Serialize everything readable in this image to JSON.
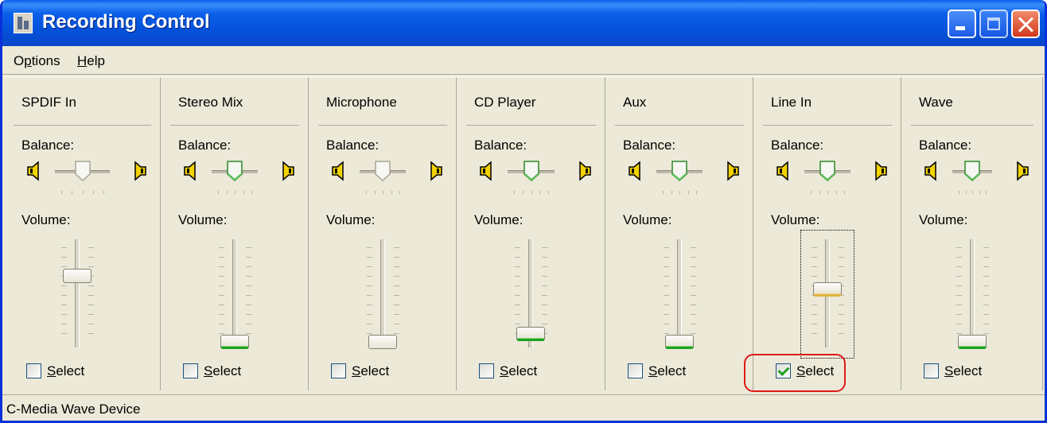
{
  "window": {
    "title": "Recording Control"
  },
  "menu": {
    "options": [
      "O",
      "p",
      "tions"
    ],
    "help": [
      "H",
      "elp"
    ]
  },
  "labels": {
    "balance": "Balance:",
    "volume": "Volume:",
    "select_first": "S",
    "select_rest": "elect"
  },
  "channels": [
    {
      "name": "SPDIF In",
      "balance": 0.5,
      "volume": 0.7,
      "selected": false,
      "active": false
    },
    {
      "name": "Stereo Mix",
      "balance": 0.5,
      "volume": 0.0,
      "selected": false,
      "active": true
    },
    {
      "name": "Microphone",
      "balance": 0.5,
      "volume": 0.0,
      "selected": false,
      "active": false
    },
    {
      "name": "CD Player",
      "balance": 0.5,
      "volume": 0.1,
      "selected": false,
      "active": true
    },
    {
      "name": "Aux",
      "balance": 0.5,
      "volume": 0.0,
      "selected": false,
      "active": true
    },
    {
      "name": "Line In",
      "balance": 0.5,
      "volume": 0.56,
      "selected": true,
      "active": true
    },
    {
      "name": "Wave",
      "balance": 0.5,
      "volume": 0.0,
      "selected": false,
      "active": true
    }
  ],
  "status": {
    "device": "C-Media Wave Device"
  },
  "colors": {
    "titlebar": "#0a5fe9",
    "window_bg": "#ece9d8",
    "selected_accent": "#21a121",
    "highlight": "#e0191b"
  }
}
